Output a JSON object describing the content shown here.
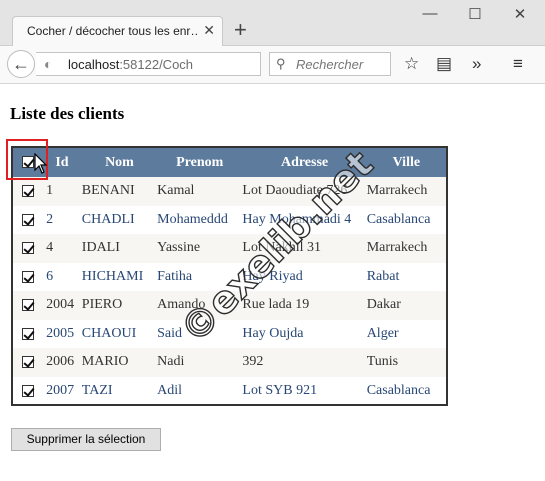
{
  "browser": {
    "tab_title": "Cocher / décocher tous les enr…",
    "tab_close": "✕",
    "new_tab": "+",
    "url_host": "localhost",
    "url_rest": ":58122/Coch",
    "search_placeholder": "Rechercher",
    "window_minimize": "—",
    "window_maximize": "☐",
    "window_close": "✕"
  },
  "page": {
    "title": "Liste des clients",
    "delete_button": "Supprimer la sélection",
    "watermark": "©exelib.net"
  },
  "grid": {
    "headers": [
      "Id",
      "Nom",
      "Prenom",
      "Adresse",
      "Ville"
    ],
    "rows": [
      {
        "id": "1",
        "nom": "BENANI",
        "prenom": "Kamal",
        "adresse": "Lot Daoudiate 726",
        "ville": "Marrakech",
        "checked": true
      },
      {
        "id": "2",
        "nom": "CHADLI",
        "prenom": "Mohameddd",
        "adresse": "Hay Mohammadi 4",
        "ville": "Casablanca",
        "checked": true
      },
      {
        "id": "4",
        "nom": "IDALI",
        "prenom": "Yassine",
        "adresse": "Lot Nakhil 31",
        "ville": "Marrakech",
        "checked": true
      },
      {
        "id": "6",
        "nom": "HICHAMI",
        "prenom": "Fatiha",
        "adresse": "Hay Riyad",
        "ville": "Rabat",
        "checked": true
      },
      {
        "id": "2004",
        "nom": "PIERO",
        "prenom": "Amando",
        "adresse": "Rue lada 19",
        "ville": "Dakar",
        "checked": true
      },
      {
        "id": "2005",
        "nom": "CHAOUI",
        "prenom": "Said",
        "adresse": "Hay Oujda",
        "ville": "Alger",
        "checked": true
      },
      {
        "id": "2006",
        "nom": "MARIO",
        "prenom": "Nadi",
        "adresse": "392",
        "ville": "Tunis",
        "checked": true
      },
      {
        "id": "2007",
        "nom": "TAZI",
        "prenom": "Adil",
        "adresse": "Lot SYB 921",
        "ville": "Casablanca",
        "checked": true
      }
    ]
  },
  "colors": {
    "header_bg": "#5d7b9d",
    "odd_row_bg": "#f7f6f3",
    "even_row_text": "#284775",
    "highlight": "#e02020"
  }
}
